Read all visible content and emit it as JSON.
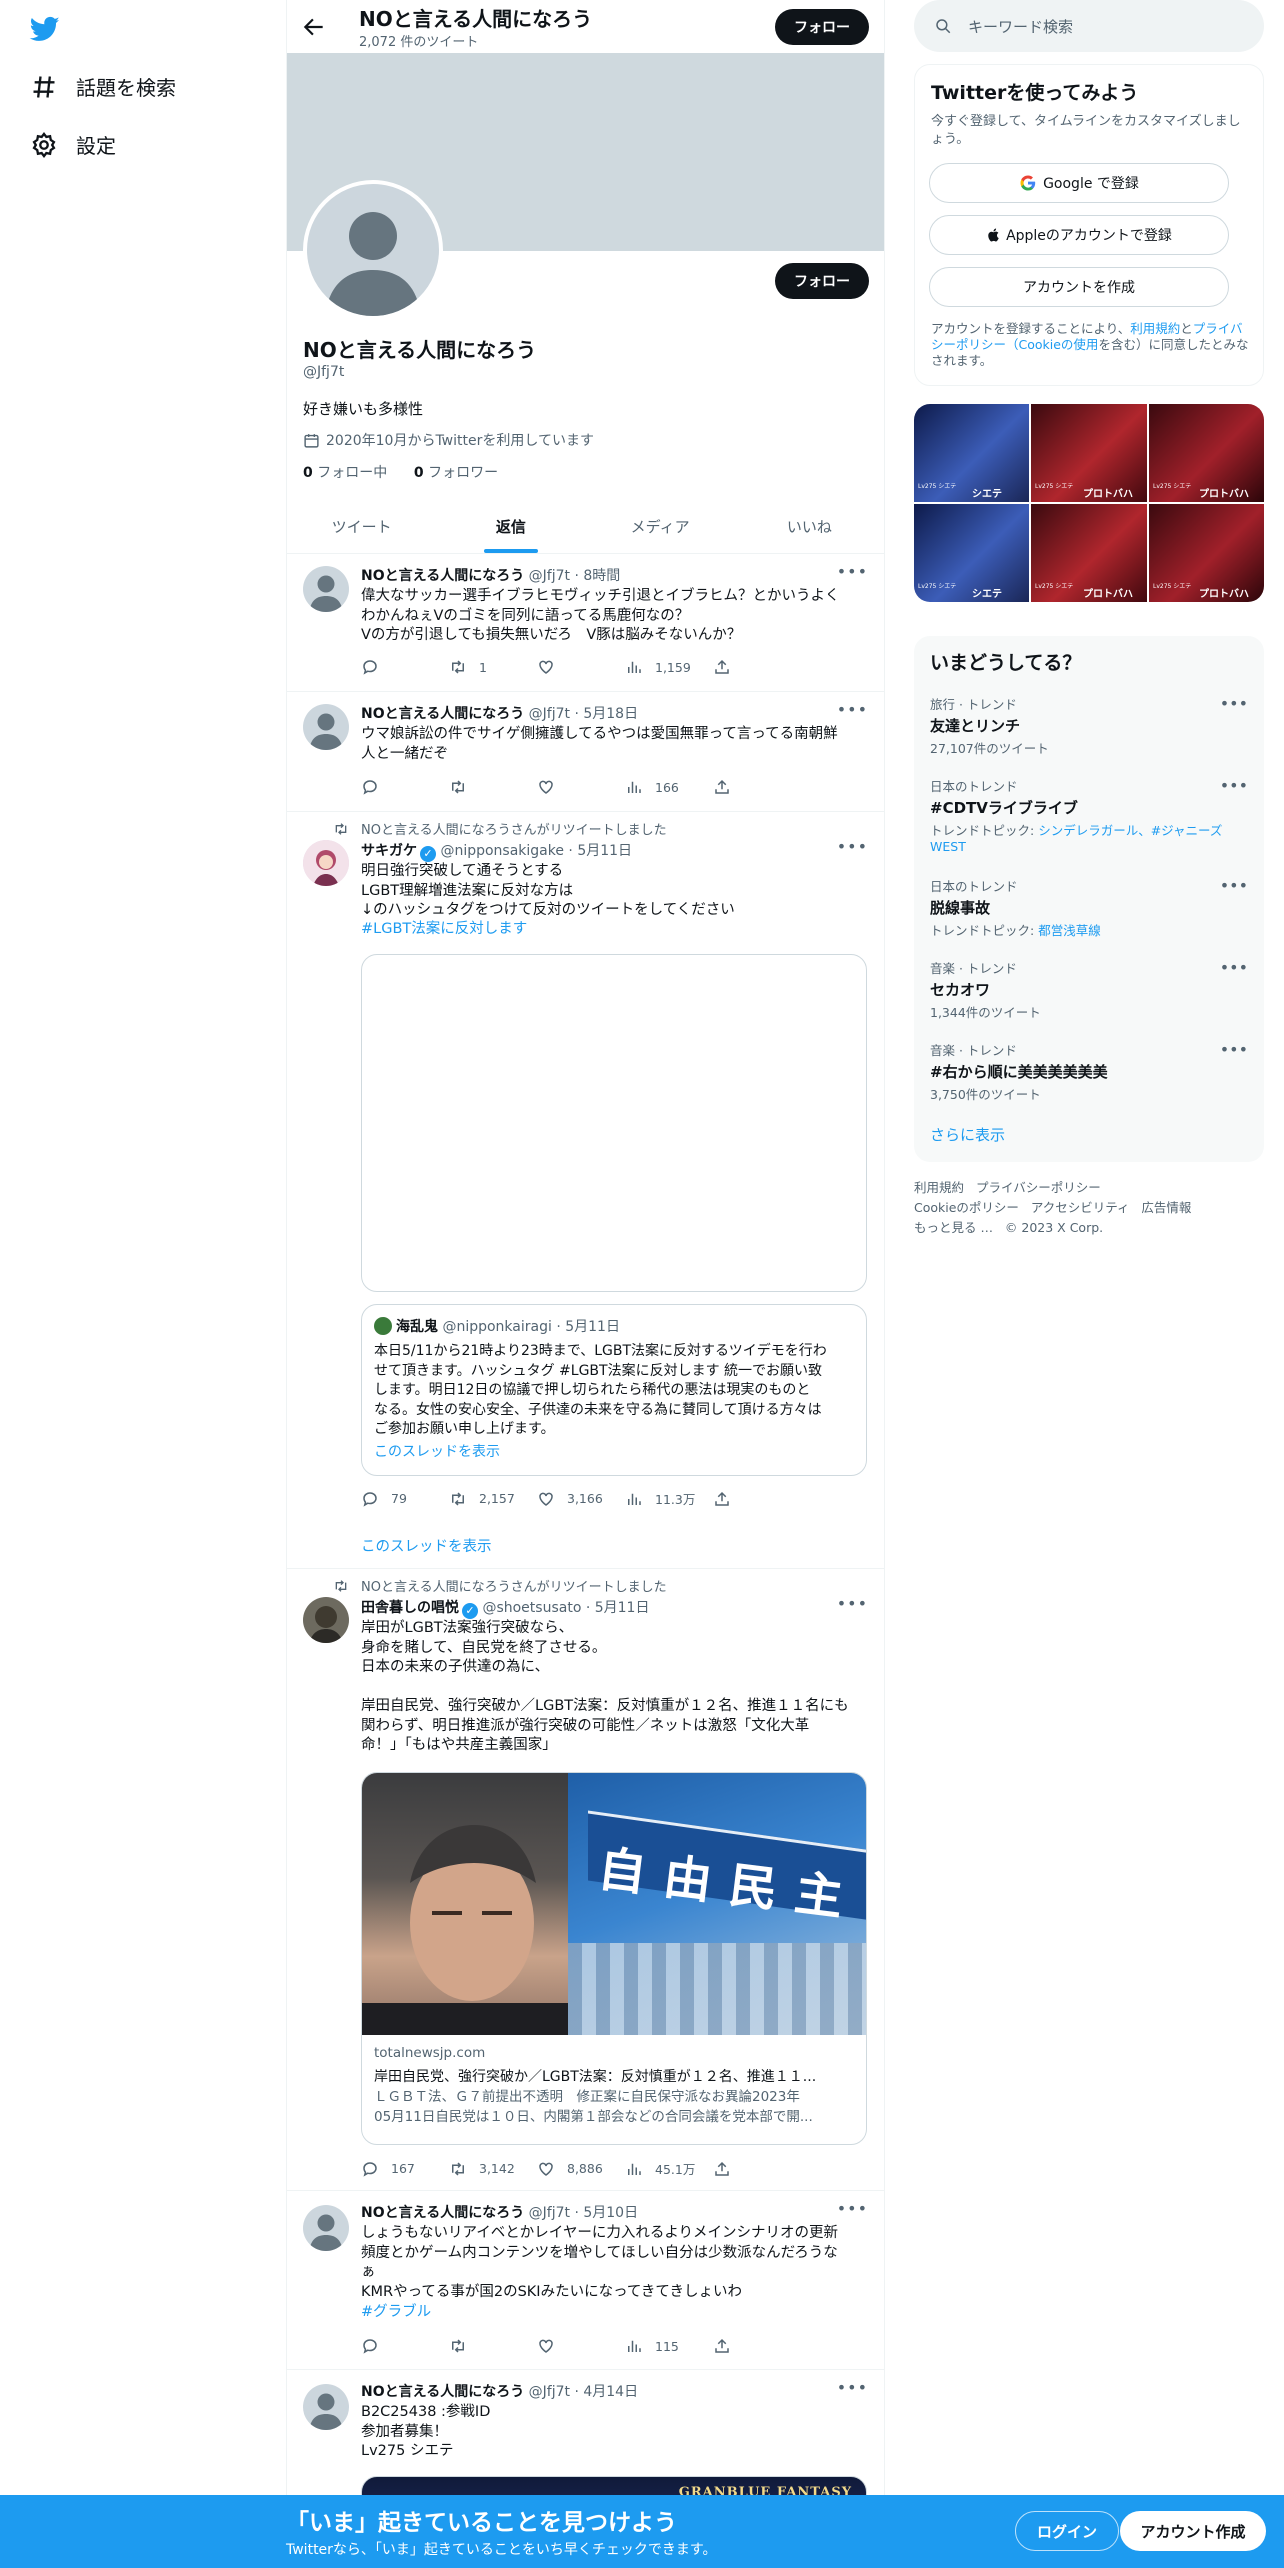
{
  "nav": {
    "explore_label": "話題を検索",
    "settings_label": "設定"
  },
  "profile_header": {
    "title": "NOと言える人間になろう",
    "tweet_count": "2,072 件のツイート",
    "follow_label": "フォロー"
  },
  "profile": {
    "name": "NOと言える人間になろう",
    "handle": "@Jfj7t",
    "bio": "好き嫌いも多様性",
    "joined": "2020年10月からTwitterを利用しています",
    "following_count": "0",
    "following_label": "フォロー中",
    "followers_count": "0",
    "followers_label": "フォロワー",
    "follow_label": "フォロー"
  },
  "tabs": [
    "ツイート",
    "返信",
    "メディア",
    "いいね"
  ],
  "tweets": [
    {
      "name": "NOと言える人間になろう",
      "meta": "@Jfj7t · 8時間",
      "text": "偉大なサッカー選手イブラヒモヴィッチ引退とイブラヒム？とかいうよく\nわかんねぇVのゴミを同列に語ってる馬鹿何なの？\nVの方が引退しても損失無いだろ　V豚は脳みそないんか？",
      "reply": "",
      "retweet": "1",
      "like": "",
      "views": "1,159"
    },
    {
      "name": "NOと言える人間になろう",
      "meta": "@Jfj7t · 5月18日",
      "text": "ウマ娘訴訟の件でサイゲ側擁護してるやつは愛国無罪って言ってる南朝鮮\n人と一緒だぞ",
      "reply": "",
      "retweet": "",
      "like": "",
      "views": "166"
    },
    {
      "rt_label": "NOと言える人間になろうさんがリツイートしました",
      "name": "サキガケ",
      "meta": "@nipponsakigake · 5月11日",
      "text": "明日強行突破して通そうとする\nLGBT理解増進法案に反対な方は\n↓のハッシュタグをつけて反対のツイートをしてください",
      "hashtag": "#LGBT法案に反対します",
      "quote_name": "海乱鬼",
      "quote_meta": "@nipponkairagi · 5月11日",
      "quote_text": "本日5/11から21時より23時まで、LGBT法案に反対するツイデモを行わ\nせて頂きます。ハッシュタグ #LGBT法案に反対します 統一でお願い致\nします。明日12日の協議で押し切られたら稀代の悪法は現実のものと\nなる。女性の安心安全、子供達の未来を守る為に賛同して頂ける方々は\nご参加お願い申し上げます。",
      "quote_thread": "このスレッドを表示",
      "reply": "79",
      "retweet": "2,157",
      "like": "3,166",
      "views": "11.3万",
      "thread_link": "このスレッドを表示"
    },
    {
      "rt_label": "NOと言える人間になろうさんがリツイートしました",
      "name": "田舎暮しの唱悦",
      "meta": "@shoetsusato · 5月11日",
      "text": "岸田がLGBT法案強行突破なら、\n身命を賭して、自民党を終了させる。\n日本の未来の子供達の為に、\n\n岸田自民党、強行突破か／LGBT法案：反対慎重が１２名、推進１１名にも\n関わらず、明日推進派が強行突破の可能性／ネットは激怒「文化大革\n命！」「もはや共産主義国家」",
      "image_sign": "自由民主",
      "link_domain": "totalnewsjp.com",
      "link_title": "岸田自民党、強行突破か／LGBT法案：反対慎重が１２名、推進１１...",
      "link_desc": "ＬＧＢＴ法、Ｇ７前提出不透明　修正案に自民保守派なお異論2023年\n05月11日自民党は１０日、内閣第１部会などの合同会議を党本部で開...",
      "reply": "167",
      "retweet": "3,142",
      "like": "8,886",
      "views": "45.1万"
    },
    {
      "name": "NOと言える人間になろう",
      "meta": "@Jfj7t · 5月10日",
      "text": "しょうもないリアイベとかレイヤーに力入れるよりメインシナリオの更新\n頻度とかゲーム内コンテンツを増やしてほしい自分は少数派なんだろうな\nぁ\nKMRやってる事が国2のSKIみたいになってきてきしょいわ",
      "hashtag": "#グラブル",
      "reply": "",
      "retweet": "",
      "like": "",
      "views": "115"
    },
    {
      "name": "NOと言える人間になろう",
      "meta": "@Jfj7t · 4月14日",
      "text": "B2C25438 :参戦ID\n参加者募集！\nLv275 シエテ",
      "image_caption": "GRANBLUE FANTASY"
    }
  ],
  "sidebar": {
    "search_placeholder": "キーワード検索",
    "signup": {
      "title": "Twitterを使ってみよう",
      "subtitle": "今すぐ登録して、タイムラインをカスタマイズしましょう。",
      "google": "Google で登録",
      "apple": "Appleのアカウントで登録",
      "create": "アカウントを作成",
      "terms_before": "アカウントを登録することにより、",
      "terms_link1": "利用規約",
      "terms_and": "と",
      "terms_link2": "プライバシーポリシー（Cookieの使用",
      "terms_after": "を含む）に同意したとみなされます。"
    },
    "media_grid_labels": [
      "Lv275 シエテ",
      "Lv275 シエテ",
      "Lv275 シエテ",
      "Lv275 シエテ",
      "Lv275 シエテ",
      "Lv275 シエテ"
    ],
    "media_grid_captions": [
      "シエテ",
      "プロトバハ",
      "プロトバハ",
      "シエテ",
      "プロトバハ",
      "プロトバハ"
    ],
    "trends_title": "いまどうしてる？",
    "trends": [
      {
        "meta": "旅行 · トレンド",
        "name": "友達とリンチ",
        "sub": "27,107件のツイート"
      },
      {
        "meta": "日本のトレンド",
        "name": "#CDTVライブライブ",
        "sub_prefix": "トレンドトピック: ",
        "sub_links": "シンデレラガール、#ジャニーズWEST"
      },
      {
        "meta": "日本のトレンド",
        "name": "脱線事故",
        "sub_prefix": "トレンドトピック: ",
        "sub_links": "都営浅草線"
      },
      {
        "meta": "音楽 · トレンド",
        "name": "セカオワ",
        "sub": "1,344件のツイート"
      },
      {
        "meta": "音楽 · トレンド",
        "name": "#右から順に美美美美美美",
        "sub": "3,750件のツイート"
      }
    ],
    "show_more": "さらに表示",
    "footer": [
      "利用規約",
      "プライバシーポリシー",
      "Cookieのポリシー",
      "アクセシビリティ",
      "広告情報",
      "もっと見る …",
      "© 2023 X Corp."
    ]
  },
  "bottom_bar": {
    "title": "「いま」起きていることを見つけよう",
    "subtitle": "Twitterなら、「いま」起きていることをいち早くチェックできます。",
    "login": "ログイン",
    "signup": "アカウント作成"
  },
  "colors": {
    "accent": "#1d9bf0",
    "text": "#0f1419",
    "muted": "#536471",
    "banner": "#cfd9de"
  }
}
